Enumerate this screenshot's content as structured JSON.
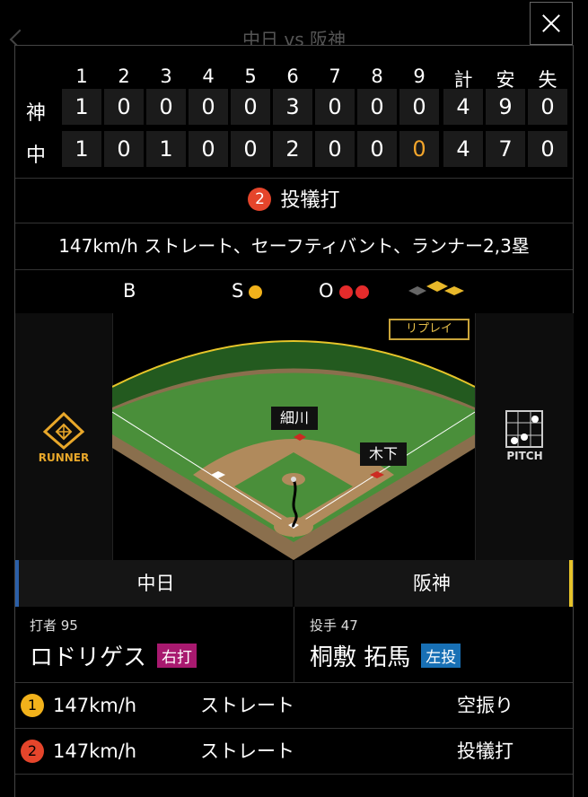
{
  "bg_title": "中日 vs 阪神",
  "scoreboard": {
    "innings": [
      "1",
      "2",
      "3",
      "4",
      "5",
      "6",
      "7",
      "8",
      "9"
    ],
    "totals_headers": [
      "計",
      "安",
      "失"
    ],
    "rows": [
      {
        "team": "神",
        "scores": [
          "1",
          "0",
          "0",
          "0",
          "0",
          "3",
          "0",
          "0",
          "0"
        ],
        "totals": [
          "4",
          "9",
          "0"
        ]
      },
      {
        "team": "中",
        "scores": [
          "1",
          "0",
          "1",
          "0",
          "0",
          "2",
          "0",
          "0",
          "0"
        ],
        "totals": [
          "4",
          "7",
          "0"
        ]
      }
    ],
    "highlight_color": "#f2a52b"
  },
  "play": {
    "number": "2",
    "result": "投犠打"
  },
  "description": "147km/h ストレート、セーフティバント、ランナー2,3塁",
  "count": {
    "b_label": "B",
    "s_label": "S",
    "o_label": "O",
    "balls": 0,
    "strikes": 1,
    "outs": 2
  },
  "field": {
    "replay_label": "リプレイ",
    "runner_label": "RUNNER",
    "pitch_label": "PITCH",
    "fielder_1b": "細川",
    "fielder_3b_side": "木下"
  },
  "tabs": {
    "home": "中日",
    "away": "阪神",
    "home_color": "#2b5fa8",
    "away_color": "#e7c32a"
  },
  "batter": {
    "role": "打者 95",
    "name": "ロドリゲス",
    "hand": "右打",
    "hand_color": "#a8196f"
  },
  "pitcher": {
    "role": "投手 47",
    "name": "桐敷 拓馬",
    "hand": "左投",
    "hand_color": "#1870b5"
  },
  "pitches": [
    {
      "num": "1",
      "speed": "147km/h",
      "type": "ストレート",
      "result": "空振り",
      "color": "#f2b21b"
    },
    {
      "num": "2",
      "speed": "147km/h",
      "type": "ストレート",
      "result": "投犠打",
      "color": "#e5452b"
    }
  ]
}
